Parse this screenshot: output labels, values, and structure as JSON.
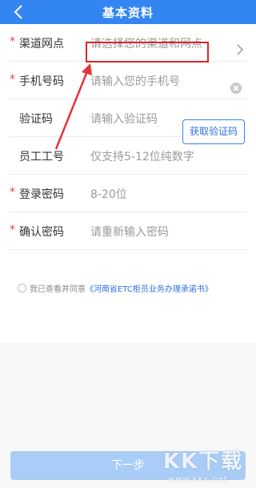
{
  "header": {
    "title": "基本资料",
    "back_icon": "chevron-left-icon"
  },
  "form": {
    "rows": [
      {
        "label": "渠道网点",
        "value": "请选择您的渠道和网点",
        "required": true
      },
      {
        "label": "手机号码",
        "value": "请输入您的手机号",
        "required": true
      },
      {
        "label": "验证码",
        "value": "请输入验证码",
        "required": false
      },
      {
        "label": "员工工号",
        "value": "仅支持5-12位纯数字",
        "required": false
      },
      {
        "label": "登录密码",
        "value": "8-20位",
        "required": true
      },
      {
        "label": "确认密码",
        "value": "请重新输入密码",
        "required": true
      }
    ],
    "required_mark": "*",
    "get_code_label": "获取验证码"
  },
  "agreement": {
    "prefix": "我已查看并同意",
    "link": "《河南省ETC柜员业务办理承诺书》"
  },
  "footer": {
    "next_label": "下一步"
  },
  "watermark": {
    "logo": "KK下载",
    "url": "www.kkx.net"
  },
  "colors": {
    "header_bg": "#3385f2",
    "required": "#e5443a",
    "highlight_box": "#d9262b",
    "link": "#2f6fe0",
    "next_button_bg": "#a9cdf7"
  }
}
